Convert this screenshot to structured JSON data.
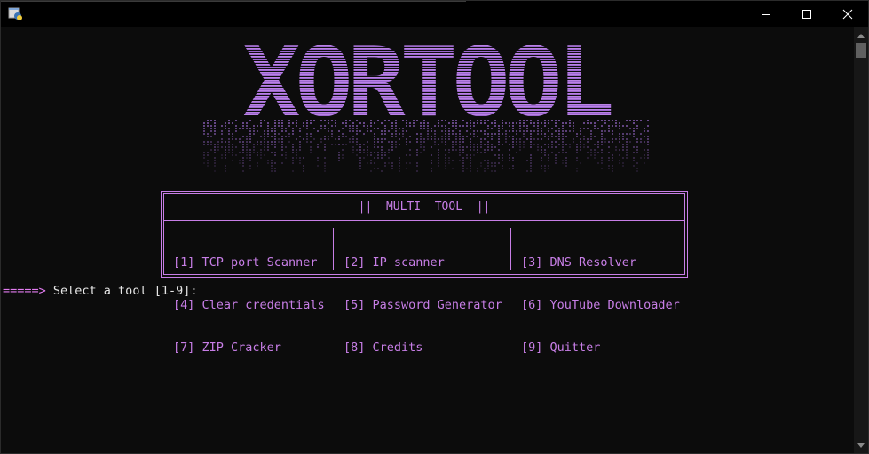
{
  "titlebar": {
    "icon": "python-console-icon",
    "controls": [
      "minimize-icon",
      "maximize-icon",
      "close-icon"
    ]
  },
  "banner": {
    "text": "XORTOOL",
    "colors": {
      "top": "#c88ff0",
      "bottom": "#8d59c2",
      "drip": "#6a4a8c"
    }
  },
  "menu": {
    "title": "||  MULTI  TOOL  ||",
    "columns": [
      [
        "[1] TCP port Scanner",
        "[4] Clear credentials",
        "[7] ZIP Cracker"
      ],
      [
        "[2] IP scanner",
        "[5] Password Generator",
        "[8] Credits"
      ],
      [
        "[3] DNS Resolver",
        "[6] YouTube Downloader",
        "[9] Quitter"
      ]
    ],
    "accent": "#c77ee6"
  },
  "prompt": {
    "arrow": "=====>",
    "text": " Select a tool [1-9]:"
  }
}
